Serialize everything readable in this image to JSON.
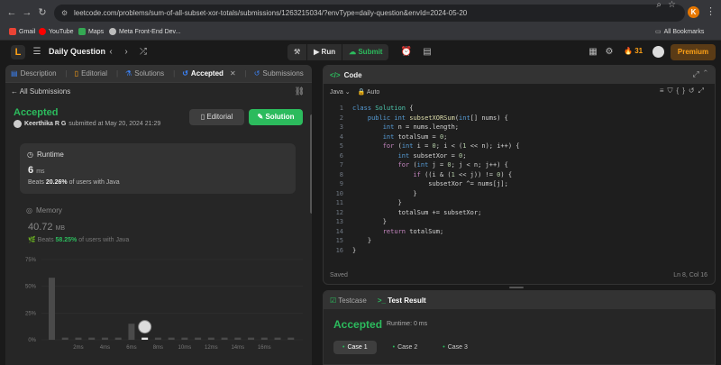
{
  "browser": {
    "url": "leetcode.com/problems/sum-of-all-subset-xor-totals/submissions/1263215034/?envType=daily-question&envId=2024-05-20",
    "bookmarks": [
      "Gmail",
      "YouTube",
      "Maps",
      "Meta Front-End Dev..."
    ],
    "all_bookmarks": "All Bookmarks",
    "profile_initial": "K"
  },
  "topbar": {
    "logo": "L",
    "title": "Daily Question",
    "run": "Run",
    "submit": "Submit",
    "streak": "31",
    "premium": "Premium"
  },
  "left_tabs": [
    {
      "label": "Description"
    },
    {
      "label": "Editorial"
    },
    {
      "label": "Solutions"
    },
    {
      "label": "Accepted"
    },
    {
      "label": "Submissions"
    }
  ],
  "submission": {
    "back_label": "All Submissions",
    "status": "Accepted",
    "user": "Keerthika R G",
    "submitted_text": "submitted at May 20, 2024 21:29",
    "editorial_btn": "Editorial",
    "solution_btn": "Solution",
    "runtime_label": "Runtime",
    "runtime_value": "6",
    "runtime_unit": "ms",
    "runtime_beats_pre": "Beats",
    "runtime_beats_pct": "20.26%",
    "runtime_beats_post": "of users with Java",
    "memory_label": "Memory",
    "memory_value": "40.72",
    "memory_unit": "MB",
    "memory_beats_pre": "Beats",
    "memory_beats_pct": "58.25%",
    "memory_beats_post": "of users with Java"
  },
  "chart_data": {
    "type": "bar",
    "y_ticks": [
      "75%",
      "50%",
      "25%",
      "0%"
    ],
    "ylim": [
      0,
      75
    ],
    "x_ticks": [
      "2ms",
      "4ms",
      "6ms",
      "8ms",
      "10ms",
      "12ms",
      "14ms",
      "16ms"
    ],
    "values": [
      58,
      2,
      2,
      2,
      2,
      2,
      15,
      2,
      2,
      2,
      2,
      2,
      2,
      2,
      2,
      2,
      2,
      2,
      2
    ],
    "highlight_index": 7
  },
  "editor": {
    "title": "Code",
    "language": "Java",
    "mode": "Auto",
    "status_left": "Saved",
    "status_right": "Ln 8, Col 16"
  },
  "code_lines": [
    "class Solution {",
    "    public int subsetXORSum(int[] nums) {",
    "        int n = nums.length;",
    "        int totalSum = 0;",
    "        for (int i = 0; i < (1 << n); i++) {",
    "            int subsetXor = 0;",
    "            for (int j = 0; j < n; j++) {",
    "                if ((i & (1 << j)) != 0) {",
    "                    subsetXor ^= nums[j];",
    "                }",
    "            }",
    "            totalSum += subsetXor;",
    "        }",
    "        return totalSum;",
    "    }",
    "}"
  ],
  "test": {
    "tab_testcase": "Testcase",
    "tab_result": "Test Result",
    "status": "Accepted",
    "runtime": "Runtime: 0 ms",
    "cases": [
      "Case 1",
      "Case 2",
      "Case 3"
    ]
  },
  "colors": {
    "accent_green": "#2cbb5d",
    "brand_orange": "#ffa116"
  }
}
